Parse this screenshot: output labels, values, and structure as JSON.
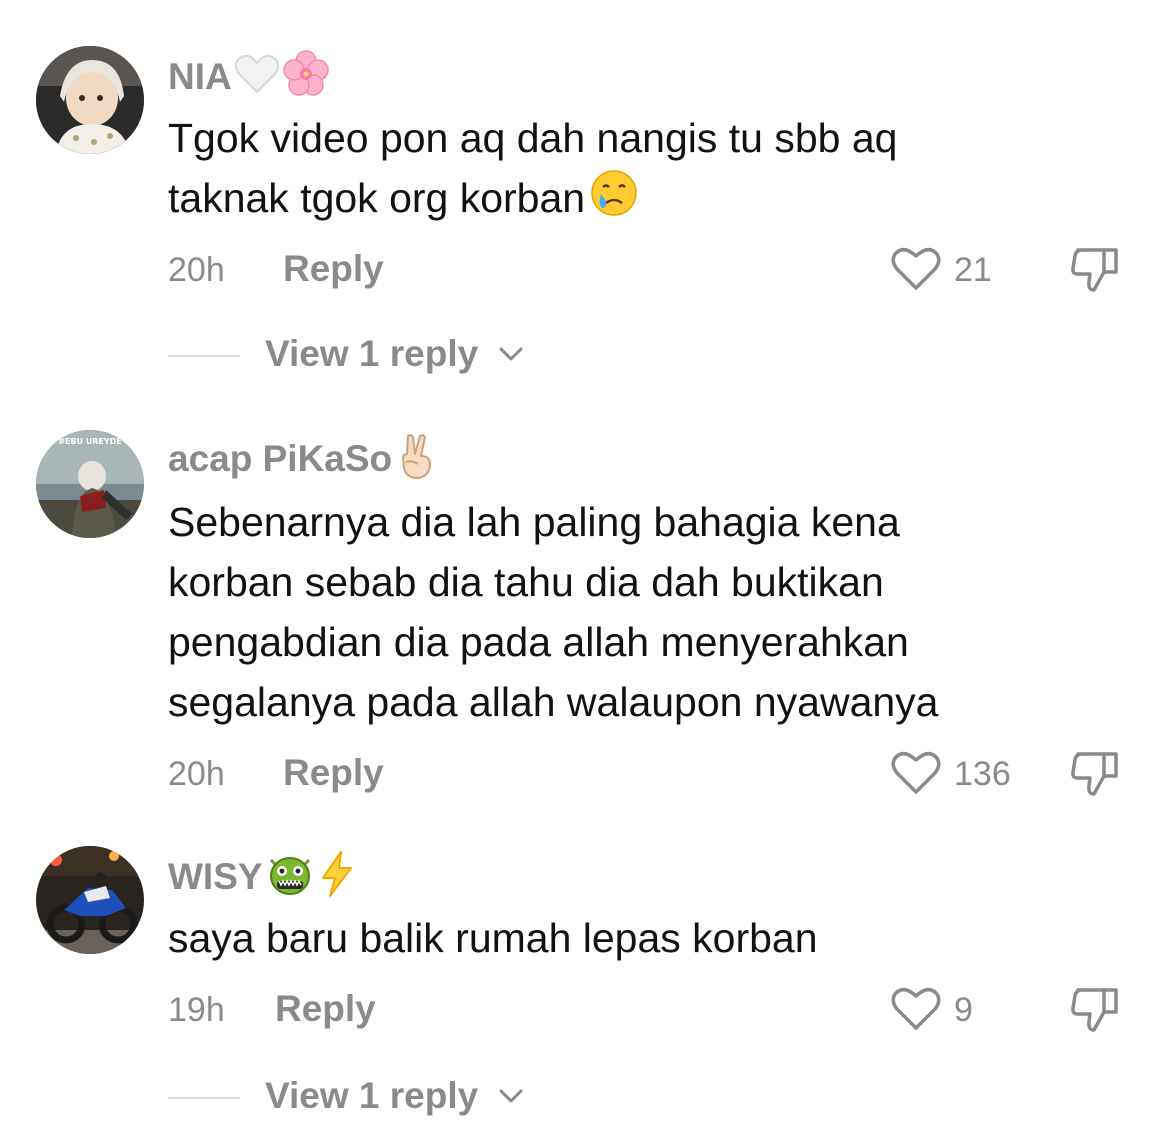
{
  "comments": [
    {
      "username": "NIA",
      "username_emojis": [
        "white-heart-emoji",
        "cherry-blossom-emoji"
      ],
      "text_lines": [
        "Tgok video pon aq dah nangis tu sbb aq",
        "taknak tgok org korban"
      ],
      "text_emoji": "crying-face-emoji",
      "time": "20h",
      "reply_label": "Reply",
      "likes": "21",
      "view_replies": "View 1 reply"
    },
    {
      "username": "acap PiKaSo",
      "username_emojis": [
        "victory-hand-emoji"
      ],
      "avatar_text": "#EBU UREYDE",
      "text_lines": [
        "Sebenarnya dia lah paling bahagia kena",
        "korban sebab dia tahu dia dah buktikan",
        "pengabdian dia pada allah menyerahkan",
        "segalanya pada allah walaupon nyawanya"
      ],
      "time": "20h",
      "reply_label": "Reply",
      "likes": "136"
    },
    {
      "username": "WISY",
      "username_emojis": [
        "dragon-face-emoji",
        "high-voltage-emoji"
      ],
      "text_lines": [
        "saya baru balik rumah lepas korban"
      ],
      "time": "19h",
      "reply_label": "Reply",
      "likes": "9",
      "view_replies": "View 1 reply"
    }
  ],
  "icons": {
    "like": "heart-outline-icon",
    "dislike": "thumbs-down-icon",
    "expand": "chevron-down-icon"
  },
  "colors": {
    "text": "#121212",
    "muted": "#8a8a8a",
    "divider": "#d9d9d9"
  }
}
